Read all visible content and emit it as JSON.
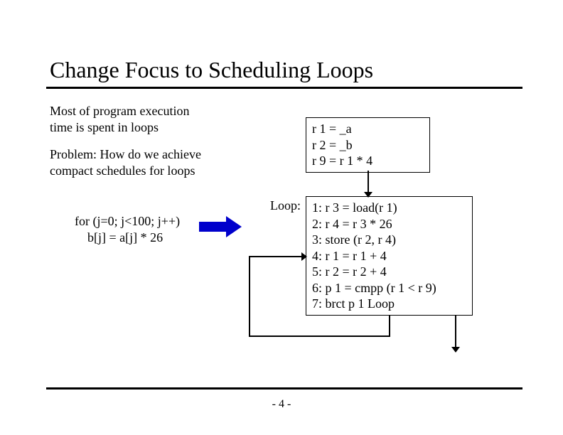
{
  "title": "Change Focus to Scheduling Loops",
  "intro1": "Most of program execution time is spent in loops",
  "intro2": "Problem:  How do we achieve compact schedules for loops",
  "forloop": {
    "line1": "for (j=0; j<100; j++)",
    "line2": "    b[j] = a[j] * 26"
  },
  "box1": {
    "line1": "r 1 = _a",
    "line2": "r 2 = _b",
    "line3": "r 9 = r 1 * 4"
  },
  "loop_label": "Loop:",
  "box2": {
    "line1": "1: r 3 = load(r 1)",
    "line2": "2: r 4 = r 3 * 26",
    "line3": "3: store (r 2, r 4)",
    "line4": "4: r 1 = r 1 + 4",
    "line5": "5: r 2 = r 2 + 4",
    "line6": "6: p 1 = cmpp (r 1 < r 9)",
    "line7": "7: brct p 1 Loop"
  },
  "pagenum": "- 4 -"
}
